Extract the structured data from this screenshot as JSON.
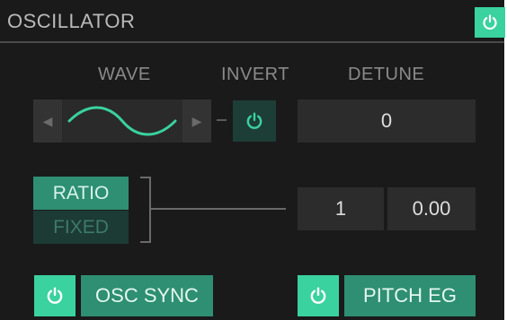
{
  "header": {
    "title": "OSCILLATOR",
    "power_icon": "power-icon"
  },
  "columns": {
    "wave": "WAVE",
    "invert": "INVERT",
    "detune": "DETUNE"
  },
  "wave": {
    "shape": "sine",
    "prev_glyph": "◀",
    "next_glyph": "▶"
  },
  "detune": {
    "value": "0"
  },
  "mode": {
    "ratio_label": "RATIO",
    "fixed_label": "FIXED",
    "selected": "RATIO"
  },
  "ratio": {
    "coarse": "1",
    "fine": "0.00"
  },
  "footer": {
    "osc_sync_label": "OSC SYNC",
    "pitch_eg_label": "PITCH EG"
  },
  "colors": {
    "accent": "#3ad29f",
    "accent_dark": "#2e8f72",
    "background": "#1a1a1a"
  }
}
